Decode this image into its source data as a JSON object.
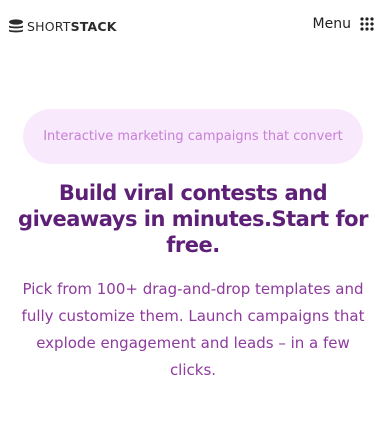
{
  "header": {
    "logo_part1": "SHORT",
    "logo_part2": "STACK",
    "menu_label": "Menu"
  },
  "hero": {
    "tagline": "Interactive marketing campaigns that convert",
    "headline": "Build viral contests and giveaways in minutes.Start for free.",
    "description": "Pick from 100+ drag-and-drop templates and fully customize them. Launch campaigns that explode engagement and leads – in a few clicks."
  },
  "colors": {
    "pill_background": "#f9e9fc",
    "pill_text": "#c77fd6",
    "headline": "#5e1f77",
    "description": "#8e3a9e"
  },
  "icons": {
    "logo": "shortstack-logo-icon",
    "menu": "grid-dots-icon"
  }
}
